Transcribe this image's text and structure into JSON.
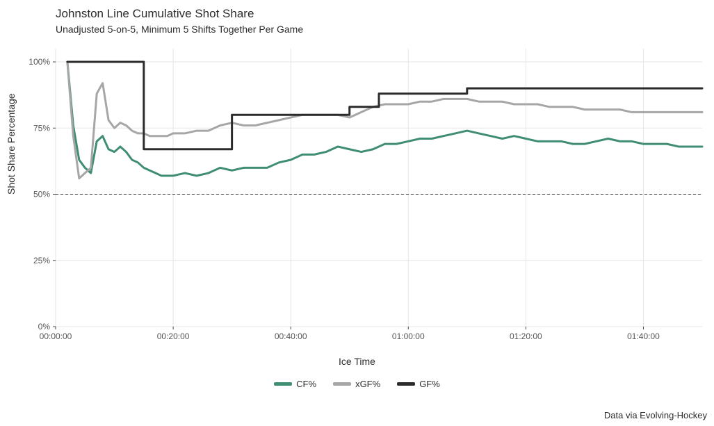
{
  "chart_data": {
    "type": "line",
    "title": "Johnston Line Cumulative Shot Share",
    "subtitle": "Unadjusted 5-on-5, Minimum 5 Shifts Together Per Game",
    "xlabel": "Ice Time",
    "ylabel": "Shot Share Percentage",
    "caption": "Data via Evolving-Hockey",
    "x_ticks": [
      "00:00:00",
      "00:20:00",
      "00:40:00",
      "01:00:00",
      "01:20:00",
      "01:40:00"
    ],
    "x_tick_minutes": [
      0,
      20,
      40,
      60,
      80,
      100
    ],
    "y_ticks": [
      "0%",
      "25%",
      "50%",
      "75%",
      "100%"
    ],
    "y_tick_values": [
      0,
      25,
      50,
      75,
      100
    ],
    "xlim": [
      0,
      110
    ],
    "ylim": [
      0,
      105
    ],
    "reference_line": 50,
    "colors": {
      "CF%": "#3f8d75",
      "xGF%": "#a6a6a6",
      "GF%": "#2b2b2b"
    },
    "series": [
      {
        "name": "CF%",
        "x": [
          2,
          3,
          4,
          5,
          6,
          7,
          8,
          9,
          10,
          11,
          12,
          13,
          14,
          15,
          16,
          17,
          18,
          19,
          20,
          22,
          24,
          26,
          28,
          30,
          32,
          34,
          36,
          38,
          40,
          42,
          44,
          46,
          48,
          50,
          52,
          54,
          56,
          58,
          60,
          62,
          64,
          66,
          68,
          70,
          72,
          74,
          76,
          78,
          80,
          82,
          84,
          86,
          88,
          90,
          92,
          94,
          96,
          98,
          100,
          102,
          104,
          106,
          108,
          110
        ],
        "values": [
          100,
          76,
          63,
          60,
          58,
          70,
          72,
          67,
          66,
          68,
          66,
          63,
          62,
          60,
          59,
          58,
          57,
          57,
          57,
          58,
          57,
          58,
          60,
          59,
          60,
          60,
          60,
          62,
          63,
          65,
          65,
          66,
          68,
          67,
          66,
          67,
          69,
          69,
          70,
          71,
          71,
          72,
          73,
          74,
          73,
          72,
          71,
          72,
          71,
          70,
          70,
          70,
          69,
          69,
          70,
          71,
          70,
          70,
          69,
          69,
          69,
          68,
          68,
          68
        ]
      },
      {
        "name": "xGF%",
        "x": [
          2,
          3,
          4,
          5,
          6,
          7,
          8,
          9,
          10,
          11,
          12,
          13,
          14,
          15,
          16,
          17,
          18,
          19,
          20,
          22,
          24,
          26,
          28,
          30,
          32,
          34,
          36,
          38,
          40,
          42,
          44,
          46,
          48,
          50,
          52,
          54,
          56,
          58,
          60,
          62,
          64,
          66,
          68,
          70,
          72,
          74,
          76,
          78,
          80,
          82,
          84,
          86,
          88,
          90,
          92,
          94,
          96,
          98,
          100,
          102,
          104,
          106,
          108,
          110
        ],
        "values": [
          100,
          72,
          56,
          58,
          60,
          88,
          92,
          78,
          75,
          77,
          76,
          74,
          73,
          73,
          72,
          72,
          72,
          72,
          73,
          73,
          74,
          74,
          76,
          77,
          76,
          76,
          77,
          78,
          79,
          80,
          80,
          80,
          80,
          79,
          81,
          83,
          84,
          84,
          84,
          85,
          85,
          86,
          86,
          86,
          85,
          85,
          85,
          84,
          84,
          84,
          83,
          83,
          83,
          82,
          82,
          82,
          82,
          81,
          81,
          81,
          81,
          81,
          81,
          81
        ]
      },
      {
        "name": "GF%",
        "x": [
          2,
          15,
          15,
          30,
          30,
          50,
          50,
          55,
          55,
          70,
          70,
          110
        ],
        "values": [
          100,
          100,
          67,
          67,
          80,
          80,
          83,
          83,
          88,
          88,
          90,
          90
        ]
      }
    ]
  }
}
